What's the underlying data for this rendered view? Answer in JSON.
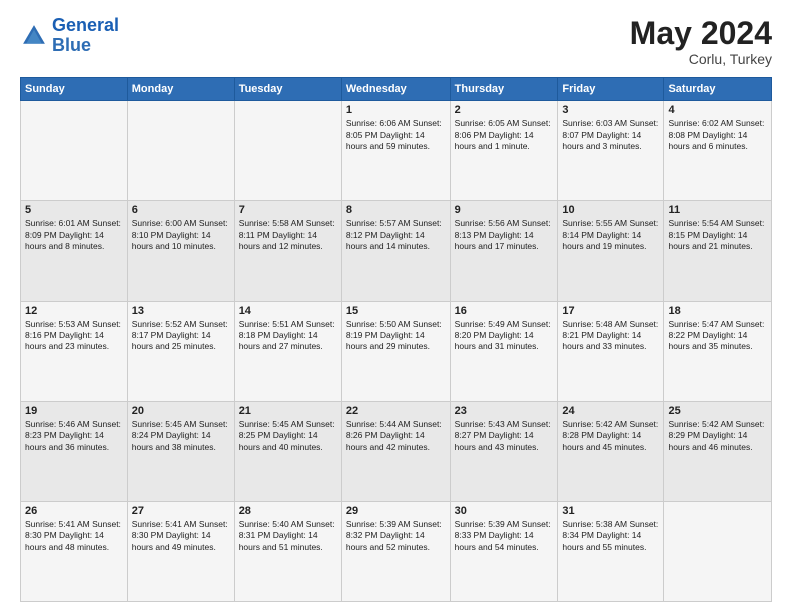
{
  "header": {
    "logo_line1": "General",
    "logo_line2": "Blue",
    "month_year": "May 2024",
    "location": "Corlu, Turkey"
  },
  "weekdays": [
    "Sunday",
    "Monday",
    "Tuesday",
    "Wednesday",
    "Thursday",
    "Friday",
    "Saturday"
  ],
  "weeks": [
    [
      {
        "day": "",
        "info": ""
      },
      {
        "day": "",
        "info": ""
      },
      {
        "day": "",
        "info": ""
      },
      {
        "day": "1",
        "info": "Sunrise: 6:06 AM\nSunset: 8:05 PM\nDaylight: 14 hours and 59 minutes."
      },
      {
        "day": "2",
        "info": "Sunrise: 6:05 AM\nSunset: 8:06 PM\nDaylight: 14 hours and 1 minute."
      },
      {
        "day": "3",
        "info": "Sunrise: 6:03 AM\nSunset: 8:07 PM\nDaylight: 14 hours and 3 minutes."
      },
      {
        "day": "4",
        "info": "Sunrise: 6:02 AM\nSunset: 8:08 PM\nDaylight: 14 hours and 6 minutes."
      }
    ],
    [
      {
        "day": "5",
        "info": "Sunrise: 6:01 AM\nSunset: 8:09 PM\nDaylight: 14 hours and 8 minutes."
      },
      {
        "day": "6",
        "info": "Sunrise: 6:00 AM\nSunset: 8:10 PM\nDaylight: 14 hours and 10 minutes."
      },
      {
        "day": "7",
        "info": "Sunrise: 5:58 AM\nSunset: 8:11 PM\nDaylight: 14 hours and 12 minutes."
      },
      {
        "day": "8",
        "info": "Sunrise: 5:57 AM\nSunset: 8:12 PM\nDaylight: 14 hours and 14 minutes."
      },
      {
        "day": "9",
        "info": "Sunrise: 5:56 AM\nSunset: 8:13 PM\nDaylight: 14 hours and 17 minutes."
      },
      {
        "day": "10",
        "info": "Sunrise: 5:55 AM\nSunset: 8:14 PM\nDaylight: 14 hours and 19 minutes."
      },
      {
        "day": "11",
        "info": "Sunrise: 5:54 AM\nSunset: 8:15 PM\nDaylight: 14 hours and 21 minutes."
      }
    ],
    [
      {
        "day": "12",
        "info": "Sunrise: 5:53 AM\nSunset: 8:16 PM\nDaylight: 14 hours and 23 minutes."
      },
      {
        "day": "13",
        "info": "Sunrise: 5:52 AM\nSunset: 8:17 PM\nDaylight: 14 hours and 25 minutes."
      },
      {
        "day": "14",
        "info": "Sunrise: 5:51 AM\nSunset: 8:18 PM\nDaylight: 14 hours and 27 minutes."
      },
      {
        "day": "15",
        "info": "Sunrise: 5:50 AM\nSunset: 8:19 PM\nDaylight: 14 hours and 29 minutes."
      },
      {
        "day": "16",
        "info": "Sunrise: 5:49 AM\nSunset: 8:20 PM\nDaylight: 14 hours and 31 minutes."
      },
      {
        "day": "17",
        "info": "Sunrise: 5:48 AM\nSunset: 8:21 PM\nDaylight: 14 hours and 33 minutes."
      },
      {
        "day": "18",
        "info": "Sunrise: 5:47 AM\nSunset: 8:22 PM\nDaylight: 14 hours and 35 minutes."
      }
    ],
    [
      {
        "day": "19",
        "info": "Sunrise: 5:46 AM\nSunset: 8:23 PM\nDaylight: 14 hours and 36 minutes."
      },
      {
        "day": "20",
        "info": "Sunrise: 5:45 AM\nSunset: 8:24 PM\nDaylight: 14 hours and 38 minutes."
      },
      {
        "day": "21",
        "info": "Sunrise: 5:45 AM\nSunset: 8:25 PM\nDaylight: 14 hours and 40 minutes."
      },
      {
        "day": "22",
        "info": "Sunrise: 5:44 AM\nSunset: 8:26 PM\nDaylight: 14 hours and 42 minutes."
      },
      {
        "day": "23",
        "info": "Sunrise: 5:43 AM\nSunset: 8:27 PM\nDaylight: 14 hours and 43 minutes."
      },
      {
        "day": "24",
        "info": "Sunrise: 5:42 AM\nSunset: 8:28 PM\nDaylight: 14 hours and 45 minutes."
      },
      {
        "day": "25",
        "info": "Sunrise: 5:42 AM\nSunset: 8:29 PM\nDaylight: 14 hours and 46 minutes."
      }
    ],
    [
      {
        "day": "26",
        "info": "Sunrise: 5:41 AM\nSunset: 8:30 PM\nDaylight: 14 hours and 48 minutes."
      },
      {
        "day": "27",
        "info": "Sunrise: 5:41 AM\nSunset: 8:30 PM\nDaylight: 14 hours and 49 minutes."
      },
      {
        "day": "28",
        "info": "Sunrise: 5:40 AM\nSunset: 8:31 PM\nDaylight: 14 hours and 51 minutes."
      },
      {
        "day": "29",
        "info": "Sunrise: 5:39 AM\nSunset: 8:32 PM\nDaylight: 14 hours and 52 minutes."
      },
      {
        "day": "30",
        "info": "Sunrise: 5:39 AM\nSunset: 8:33 PM\nDaylight: 14 hours and 54 minutes."
      },
      {
        "day": "31",
        "info": "Sunrise: 5:38 AM\nSunset: 8:34 PM\nDaylight: 14 hours and 55 minutes."
      },
      {
        "day": "",
        "info": ""
      }
    ]
  ]
}
